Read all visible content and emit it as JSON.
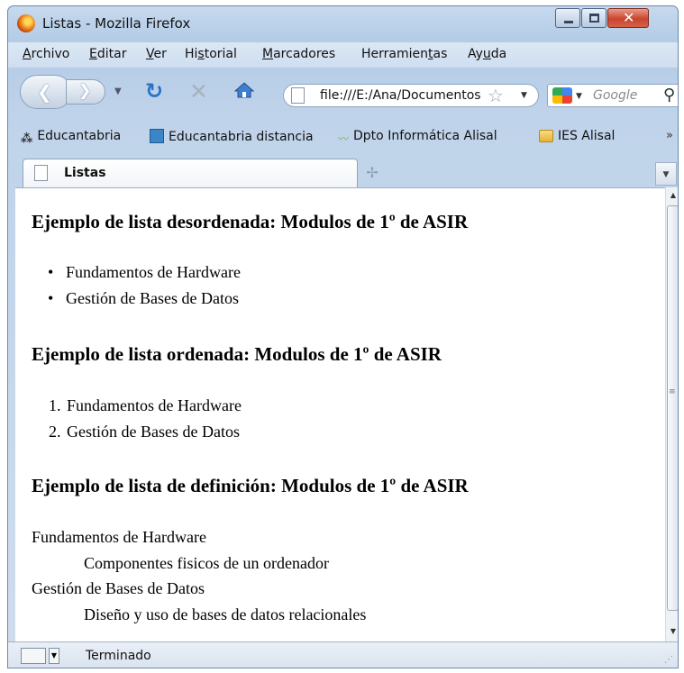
{
  "window": {
    "title": "Listas - Mozilla Firefox"
  },
  "menu": {
    "items": [
      {
        "pre": "",
        "u": "A",
        "post": "rchivo"
      },
      {
        "pre": "",
        "u": "E",
        "post": "ditar"
      },
      {
        "pre": "",
        "u": "V",
        "post": "er"
      },
      {
        "pre": "Hi",
        "u": "s",
        "post": "torial"
      },
      {
        "pre": "",
        "u": "M",
        "post": "arcadores"
      },
      {
        "pre": "Herramien",
        "u": "t",
        "post": "as"
      },
      {
        "pre": "Ay",
        "u": "u",
        "post": "da"
      }
    ]
  },
  "nav": {
    "url": "file:///E:/Ana/Documentos",
    "search_placeholder": "Google"
  },
  "bookmarks": {
    "items": [
      {
        "label": "Educantabria",
        "icon": "educantabria-icon"
      },
      {
        "label": "Educantabria distancia",
        "icon": "moodle-icon"
      },
      {
        "label": "Dpto Informática Alisal",
        "icon": "bird-icon"
      },
      {
        "label": "IES Alisal",
        "icon": "folder-icon"
      }
    ],
    "more": "»"
  },
  "tabs": [
    {
      "label": "Listas"
    }
  ],
  "content": {
    "unordered_heading": "Ejemplo de lista desordenada: Modulos de 1º de ASIR",
    "unordered_items": [
      "Fundamentos de Hardware",
      "Gestión de Bases de Datos"
    ],
    "ordered_heading": "Ejemplo de lista ordenada: Modulos de 1º de ASIR",
    "ordered_items": [
      "Fundamentos de Hardware",
      "Gestión de Bases de Datos"
    ],
    "definition_heading": "Ejemplo de lista de definición: Modulos de 1º de ASIR",
    "definitions": [
      {
        "term": "Fundamentos de Hardware",
        "desc": "Componentes fisicos de un ordenador"
      },
      {
        "term": "Gestión de Bases de Datos",
        "desc": "Diseño y uso de bases de datos relacionales"
      }
    ],
    "bullet": "•",
    "markers": [
      "1.",
      "2."
    ]
  },
  "status": {
    "text": "Terminado"
  },
  "colors": {
    "window_frame": "#b3cbe6",
    "close_button": "#c8452c",
    "link_blue": "#2a72c8"
  }
}
